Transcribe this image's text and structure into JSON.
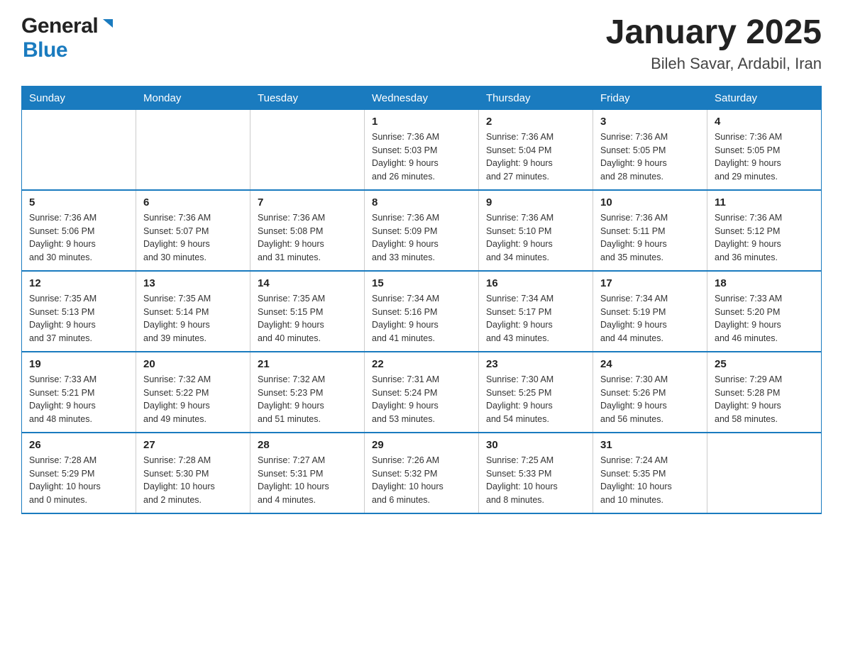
{
  "header": {
    "logo_general": "General",
    "logo_blue": "Blue",
    "title": "January 2025",
    "subtitle": "Bileh Savar, Ardabil, Iran"
  },
  "calendar": {
    "days_of_week": [
      "Sunday",
      "Monday",
      "Tuesday",
      "Wednesday",
      "Thursday",
      "Friday",
      "Saturday"
    ],
    "weeks": [
      [
        {
          "day": "",
          "info": ""
        },
        {
          "day": "",
          "info": ""
        },
        {
          "day": "",
          "info": ""
        },
        {
          "day": "1",
          "info": "Sunrise: 7:36 AM\nSunset: 5:03 PM\nDaylight: 9 hours\nand 26 minutes."
        },
        {
          "day": "2",
          "info": "Sunrise: 7:36 AM\nSunset: 5:04 PM\nDaylight: 9 hours\nand 27 minutes."
        },
        {
          "day": "3",
          "info": "Sunrise: 7:36 AM\nSunset: 5:05 PM\nDaylight: 9 hours\nand 28 minutes."
        },
        {
          "day": "4",
          "info": "Sunrise: 7:36 AM\nSunset: 5:05 PM\nDaylight: 9 hours\nand 29 minutes."
        }
      ],
      [
        {
          "day": "5",
          "info": "Sunrise: 7:36 AM\nSunset: 5:06 PM\nDaylight: 9 hours\nand 30 minutes."
        },
        {
          "day": "6",
          "info": "Sunrise: 7:36 AM\nSunset: 5:07 PM\nDaylight: 9 hours\nand 30 minutes."
        },
        {
          "day": "7",
          "info": "Sunrise: 7:36 AM\nSunset: 5:08 PM\nDaylight: 9 hours\nand 31 minutes."
        },
        {
          "day": "8",
          "info": "Sunrise: 7:36 AM\nSunset: 5:09 PM\nDaylight: 9 hours\nand 33 minutes."
        },
        {
          "day": "9",
          "info": "Sunrise: 7:36 AM\nSunset: 5:10 PM\nDaylight: 9 hours\nand 34 minutes."
        },
        {
          "day": "10",
          "info": "Sunrise: 7:36 AM\nSunset: 5:11 PM\nDaylight: 9 hours\nand 35 minutes."
        },
        {
          "day": "11",
          "info": "Sunrise: 7:36 AM\nSunset: 5:12 PM\nDaylight: 9 hours\nand 36 minutes."
        }
      ],
      [
        {
          "day": "12",
          "info": "Sunrise: 7:35 AM\nSunset: 5:13 PM\nDaylight: 9 hours\nand 37 minutes."
        },
        {
          "day": "13",
          "info": "Sunrise: 7:35 AM\nSunset: 5:14 PM\nDaylight: 9 hours\nand 39 minutes."
        },
        {
          "day": "14",
          "info": "Sunrise: 7:35 AM\nSunset: 5:15 PM\nDaylight: 9 hours\nand 40 minutes."
        },
        {
          "day": "15",
          "info": "Sunrise: 7:34 AM\nSunset: 5:16 PM\nDaylight: 9 hours\nand 41 minutes."
        },
        {
          "day": "16",
          "info": "Sunrise: 7:34 AM\nSunset: 5:17 PM\nDaylight: 9 hours\nand 43 minutes."
        },
        {
          "day": "17",
          "info": "Sunrise: 7:34 AM\nSunset: 5:19 PM\nDaylight: 9 hours\nand 44 minutes."
        },
        {
          "day": "18",
          "info": "Sunrise: 7:33 AM\nSunset: 5:20 PM\nDaylight: 9 hours\nand 46 minutes."
        }
      ],
      [
        {
          "day": "19",
          "info": "Sunrise: 7:33 AM\nSunset: 5:21 PM\nDaylight: 9 hours\nand 48 minutes."
        },
        {
          "day": "20",
          "info": "Sunrise: 7:32 AM\nSunset: 5:22 PM\nDaylight: 9 hours\nand 49 minutes."
        },
        {
          "day": "21",
          "info": "Sunrise: 7:32 AM\nSunset: 5:23 PM\nDaylight: 9 hours\nand 51 minutes."
        },
        {
          "day": "22",
          "info": "Sunrise: 7:31 AM\nSunset: 5:24 PM\nDaylight: 9 hours\nand 53 minutes."
        },
        {
          "day": "23",
          "info": "Sunrise: 7:30 AM\nSunset: 5:25 PM\nDaylight: 9 hours\nand 54 minutes."
        },
        {
          "day": "24",
          "info": "Sunrise: 7:30 AM\nSunset: 5:26 PM\nDaylight: 9 hours\nand 56 minutes."
        },
        {
          "day": "25",
          "info": "Sunrise: 7:29 AM\nSunset: 5:28 PM\nDaylight: 9 hours\nand 58 minutes."
        }
      ],
      [
        {
          "day": "26",
          "info": "Sunrise: 7:28 AM\nSunset: 5:29 PM\nDaylight: 10 hours\nand 0 minutes."
        },
        {
          "day": "27",
          "info": "Sunrise: 7:28 AM\nSunset: 5:30 PM\nDaylight: 10 hours\nand 2 minutes."
        },
        {
          "day": "28",
          "info": "Sunrise: 7:27 AM\nSunset: 5:31 PM\nDaylight: 10 hours\nand 4 minutes."
        },
        {
          "day": "29",
          "info": "Sunrise: 7:26 AM\nSunset: 5:32 PM\nDaylight: 10 hours\nand 6 minutes."
        },
        {
          "day": "30",
          "info": "Sunrise: 7:25 AM\nSunset: 5:33 PM\nDaylight: 10 hours\nand 8 minutes."
        },
        {
          "day": "31",
          "info": "Sunrise: 7:24 AM\nSunset: 5:35 PM\nDaylight: 10 hours\nand 10 minutes."
        },
        {
          "day": "",
          "info": ""
        }
      ]
    ]
  }
}
